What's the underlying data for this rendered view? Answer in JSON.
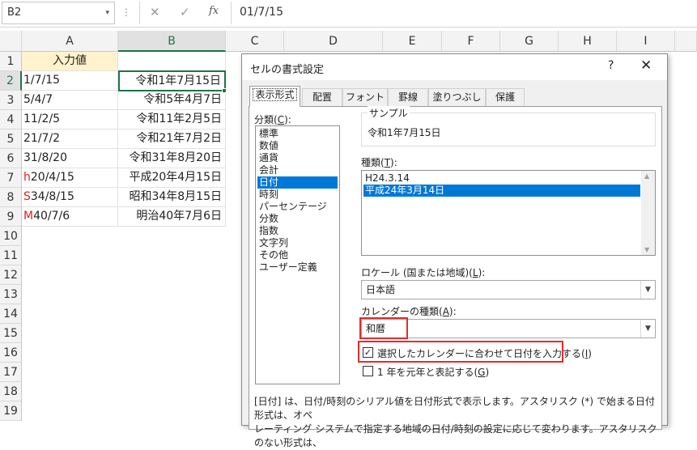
{
  "formula_bar": {
    "name_box": "B2",
    "name_box_arrow": "▾",
    "dots": "⋮",
    "cancel_icon": "✕",
    "enter_icon": "✓",
    "fx_label": "fx",
    "value": "01/7/15"
  },
  "columns": [
    "A",
    "B",
    "C",
    "D",
    "E",
    "F",
    "G",
    "H",
    "I"
  ],
  "rows": [
    "1",
    "2",
    "3",
    "4",
    "5",
    "6",
    "7",
    "8",
    "9",
    "10",
    "11",
    "12",
    "13",
    "14",
    "15",
    "16",
    "17",
    "18",
    "19"
  ],
  "cells": {
    "header_a1": "入力値",
    "col_a": [
      {
        "prefix": "",
        "text": "1/7/15"
      },
      {
        "prefix": "",
        "text": "5/4/7"
      },
      {
        "prefix": "",
        "text": "11/2/5"
      },
      {
        "prefix": "",
        "text": "21/7/2"
      },
      {
        "prefix": "",
        "text": "31/8/20"
      },
      {
        "prefix": "h",
        "text": "20/4/15"
      },
      {
        "prefix": "S",
        "text": "34/8/15"
      },
      {
        "prefix": "M",
        "text": "40/7/6"
      }
    ],
    "col_b": [
      "令和1年7月15日",
      "令和5年4月7日",
      "令和11年2月5日",
      "令和21年7月2日",
      "令和31年8月20日",
      "平成20年4月15日",
      "昭和34年8月15日",
      "明治40年7月6日"
    ]
  },
  "dialog": {
    "title": "セルの書式設定",
    "help": "?",
    "close": "✕",
    "tabs": [
      "表示形式",
      "配置",
      "フォント",
      "罫線",
      "塗りつぶし",
      "保護"
    ],
    "active_tab": "表示形式",
    "category_label_pre": "分類(",
    "category_label_key": "C",
    "category_label_post": "):",
    "categories": [
      "標準",
      "数値",
      "通貨",
      "会計",
      "日付",
      "時刻",
      "パーセンテージ",
      "分数",
      "指数",
      "文字列",
      "その他",
      "ユーザー定義"
    ],
    "selected_category": "日付",
    "sample_label": "サンプル",
    "sample_value": "令和1年7月15日",
    "type_label_pre": "種類(",
    "type_label_key": "T",
    "type_label_post": "):",
    "types": [
      "H24.3.14",
      "平成24年3月14日"
    ],
    "selected_type": "平成24年3月14日",
    "locale_label_pre": "ロケール (国または地域)(",
    "locale_label_key": "L",
    "locale_label_post": "):",
    "locale_value": "日本語",
    "calendar_label_pre": "カレンダーの種類(",
    "calendar_label_key": "A",
    "calendar_label_post": "):",
    "calendar_value": "和暦",
    "checkbox1_pre": "選択したカレンダーに合わせて日付を入力する(",
    "checkbox1_key": "I",
    "checkbox1_post": ")",
    "checkbox1_checked": true,
    "checkbox2_pre": "1 年を元年と表記する(",
    "checkbox2_key": "G",
    "checkbox2_post": ")",
    "checkbox2_checked": false,
    "description_line1": "[日付] は、日付/時刻のシリアル値を日付形式で表示します。アスタリスク (*) で始まる日付形式は、オペ",
    "description_line2": "レーティング システムで指定する地域の日付/時刻の設定に応じて変わります。アスタリスクのない形式は、"
  },
  "colors": {
    "excel_green": "#217346",
    "selection_blue": "#0078d7",
    "highlight_red": "#e52b2b",
    "header_fill": "#fff2cc"
  }
}
